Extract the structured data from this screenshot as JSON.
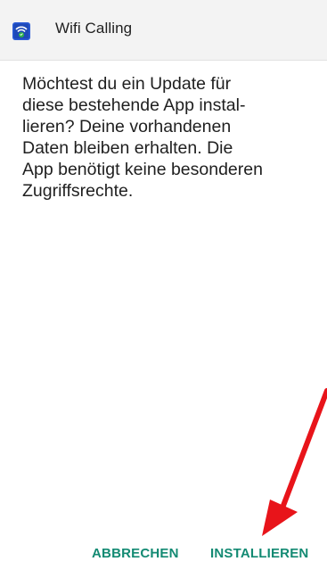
{
  "header": {
    "app_icon": "wifi-calling-app-icon",
    "title": "Wifi Calling"
  },
  "dialog": {
    "message": "Möchtest du ein Update für\ndiese bestehende App instal-\nlieren? Deine vorhandenen\nDaten bleiben erhalten. Die\nApp benötigt keine besonderen\nZugriffsrechte."
  },
  "actions": {
    "cancel_label": "ABBRECHEN",
    "install_label": "INSTALLIEREN"
  },
  "annotation": {
    "type": "red-arrow",
    "points_to": "install-button"
  },
  "colors": {
    "accent": "#138a73",
    "header_bg": "#f3f3f3",
    "arrow": "#e8141a",
    "icon_blue": "#2a5bd7",
    "icon_green": "#2fb24a"
  }
}
